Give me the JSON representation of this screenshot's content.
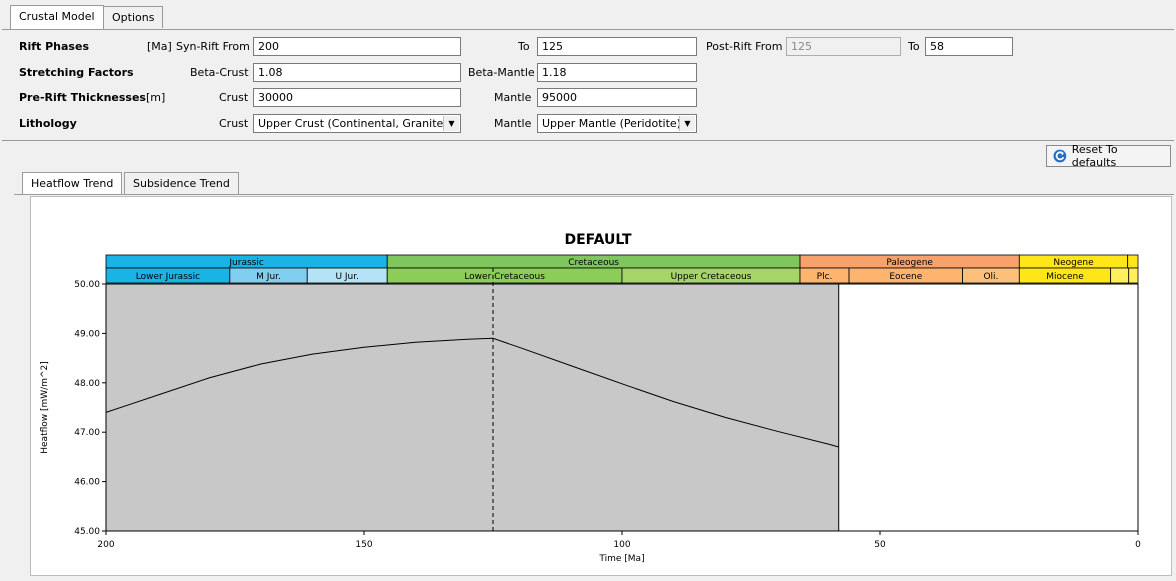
{
  "tabs": [
    "Crustal Model",
    "Options"
  ],
  "form": {
    "rift_phases": {
      "label": "Rift Phases",
      "unit": "[Ma]",
      "syn_rift_from_label": "Syn-Rift From",
      "syn_rift_from_value": "200",
      "to_label": "To",
      "syn_rift_to_value": "125",
      "post_rift_from_label": "Post-Rift From",
      "post_rift_from_value": "125",
      "post_to_label": "To",
      "post_rift_to_value": "58"
    },
    "stretching": {
      "label": "Stretching Factors",
      "beta_crust_label": "Beta-Crust",
      "beta_crust_value": "1.08",
      "beta_mantle_label": "Beta-Mantle",
      "beta_mantle_value": "1.18"
    },
    "thickness": {
      "label": "Pre-Rift Thicknesses",
      "unit": "[m]",
      "crust_label": "Crust",
      "crust_value": "30000",
      "mantle_label": "Mantle",
      "mantle_value": "95000"
    },
    "lithology": {
      "label": "Lithology",
      "crust_label": "Crust",
      "crust_value": "Upper Crust (Continental, Granite)",
      "mantle_label": "Mantle",
      "mantle_value": "Upper Mantle (Peridotite)"
    }
  },
  "reset_button": "Reset To defaults",
  "inner_tabs": [
    "Heatflow Trend",
    "Subsidence Trend"
  ],
  "colors": {
    "jurassic": "#1ab3e6",
    "jurassic_light": "#80cff0",
    "cretaceous": "#7fc65e",
    "cretaceous_light": "#a6d468",
    "paleogene": "#f7a26c",
    "neogene": "#ffe619",
    "plot_grey": "#c8c8c8"
  },
  "chart_data": {
    "type": "line",
    "title": "DEFAULT",
    "xlabel": "Time [Ma]",
    "ylabel": "Heatflow [mW/m^2]",
    "xlim": [
      200,
      0
    ],
    "ylim": [
      45.0,
      50.0
    ],
    "xticks": [
      "200",
      "150",
      "100",
      "50",
      "0"
    ],
    "yticks": [
      "45.00",
      "46.00",
      "47.00",
      "48.00",
      "49.00",
      "50.00"
    ],
    "shaded_until_ma": 58,
    "vline_ma": 125,
    "series": [
      {
        "x": [
          200,
          190,
          180,
          170,
          160,
          150,
          140,
          130,
          125,
          120,
          110,
          100,
          90,
          80,
          70,
          60,
          58
        ],
        "y": [
          47.4,
          47.75,
          48.1,
          48.38,
          48.58,
          48.72,
          48.82,
          48.88,
          48.9,
          48.72,
          48.35,
          47.98,
          47.62,
          47.3,
          47.02,
          46.76,
          46.7
        ]
      }
    ],
    "eras": [
      {
        "name": "Jurassic",
        "from": 200,
        "to": 145.5,
        "color": "#1ab3e6"
      },
      {
        "name": "Cretaceous",
        "from": 145.5,
        "to": 65.5,
        "color": "#7fc65e"
      },
      {
        "name": "Paleogene",
        "from": 65.5,
        "to": 23,
        "color": "#f7a26c"
      },
      {
        "name": "Neogene",
        "from": 23,
        "to": 2,
        "color": "#ffe619"
      },
      {
        "name": "",
        "from": 2,
        "to": 0,
        "color": "#ffe619"
      }
    ],
    "epochs": [
      {
        "name": "Lower Jurassic",
        "from": 200,
        "to": 176,
        "color": "#1ab3e6"
      },
      {
        "name": "M Jur.",
        "from": 176,
        "to": 161,
        "color": "#80cff0"
      },
      {
        "name": "U Jur.",
        "from": 161,
        "to": 145.5,
        "color": "#b3e3f5"
      },
      {
        "name": "Lower Cretaceous",
        "from": 145.5,
        "to": 100,
        "color": "#8ccd57"
      },
      {
        "name": "Upper Cretaceous",
        "from": 100,
        "to": 65.5,
        "color": "#a6d468"
      },
      {
        "name": "Plc.",
        "from": 65.5,
        "to": 56,
        "color": "#fdb46c"
      },
      {
        "name": "Eocene",
        "from": 56,
        "to": 34,
        "color": "#fdb46c"
      },
      {
        "name": "Oli.",
        "from": 34,
        "to": 23,
        "color": "#fdc07a"
      },
      {
        "name": "Miocene",
        "from": 23,
        "to": 5.3,
        "color": "#ffe619"
      },
      {
        "name": "",
        "from": 5.3,
        "to": 1.8,
        "color": "#ffef5a"
      },
      {
        "name": "",
        "from": 1.8,
        "to": 0,
        "color": "#ffef5a"
      }
    ]
  }
}
